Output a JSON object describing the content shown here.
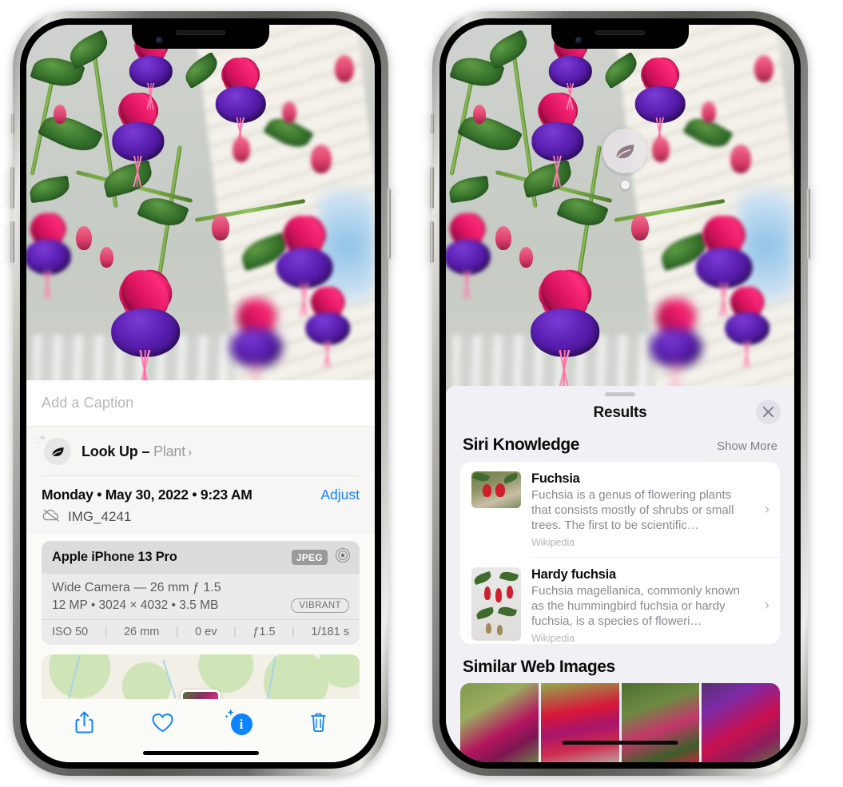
{
  "left_phone": {
    "photo": {
      "alt": "fuchsia-flowers-photo"
    },
    "caption": {
      "placeholder": "Add a Caption",
      "value": ""
    },
    "look_up": {
      "label": "Look Up – ",
      "subject": "Plant",
      "chevron": "›",
      "icon": "leaf-icon",
      "sparkle_icon": "sparkles-icon"
    },
    "meta": {
      "date": "Monday • May 30, 2022 • 9:23 AM",
      "adjust_label": "Adjust",
      "filename": "IMG_4241",
      "cloud_icon": "cloud-slash-icon"
    },
    "exif": {
      "device": "Apple iPhone 13 Pro",
      "format_tag": "JPEG",
      "aperture_icon": "lens-icon",
      "lens_line": "Wide Camera — 26 mm ƒ 1.5",
      "specs_line": "12 MP • 3024 × 4032 • 3.5 MB",
      "style_tag": "VIBRANT",
      "settings": [
        "ISO 50",
        "26 mm",
        "0 ev",
        "ƒ1.5",
        "1/181 s"
      ]
    },
    "map": {
      "name": "location-map"
    },
    "toolbar": [
      {
        "name": "share-icon",
        "label": "Share"
      },
      {
        "name": "heart-icon",
        "label": "Favorite"
      },
      {
        "name": "info-icon",
        "label": "Info"
      },
      {
        "name": "trash-icon",
        "label": "Delete"
      }
    ]
  },
  "right_phone": {
    "visual_lookup_badge": {
      "icon": "leaf-icon",
      "name": "visual-look-up-badge"
    },
    "results": {
      "title": "Results",
      "close_icon": "close-icon",
      "sections": [
        {
          "title": "Siri Knowledge",
          "action_label": "Show More",
          "items": [
            {
              "title": "Fuchsia",
              "description": "Fuchsia is a genus of flowering plants that consists mostly of shrubs or small trees. The first to be scientific…",
              "source": "Wikipedia",
              "chevron": "›"
            },
            {
              "title": "Hardy fuchsia",
              "description": "Fuchsia magellanica, commonly known as the hummingbird fuchsia or hardy fuchsia, is a species of floweri…",
              "source": "Wikipedia",
              "chevron": "›"
            }
          ]
        },
        {
          "title": "Similar Web Images",
          "images": [
            "web-image-1",
            "web-image-2",
            "web-image-3",
            "web-image-4"
          ]
        }
      ]
    }
  },
  "colors": {
    "accent_blue": "#0a84ff",
    "sheet_bg": "#fbfbf8",
    "results_bg": "#f1f0f5",
    "exif_bg": "#ebebeb",
    "muted_text": "#8a8a90"
  }
}
